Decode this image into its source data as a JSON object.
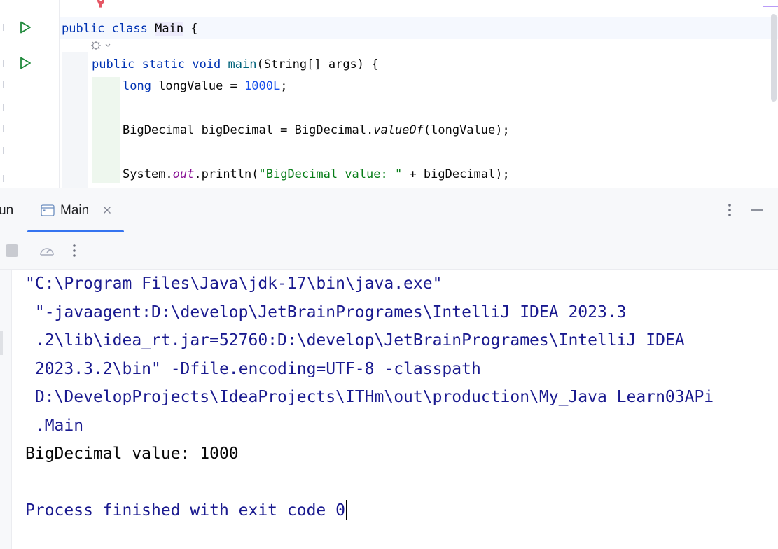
{
  "editor": {
    "lines": [
      {
        "id": "class-decl",
        "tokens": [
          {
            "t": "public",
            "c": "kw"
          },
          {
            "t": " ",
            "c": ""
          },
          {
            "t": "class",
            "c": "kw"
          },
          {
            "t": " ",
            "c": ""
          },
          {
            "t": "Main",
            "c": "cls-hl"
          },
          {
            "t": " {",
            "c": ""
          }
        ]
      },
      {
        "id": "main-decl",
        "tokens": [
          {
            "t": "public",
            "c": "kw"
          },
          {
            "t": " ",
            "c": ""
          },
          {
            "t": "static",
            "c": "kw"
          },
          {
            "t": " ",
            "c": ""
          },
          {
            "t": "void",
            "c": "kw"
          },
          {
            "t": " ",
            "c": ""
          },
          {
            "t": "main",
            "c": "method-decl"
          },
          {
            "t": "(String[] args) {",
            "c": ""
          }
        ]
      },
      {
        "id": "long-decl",
        "tokens": [
          {
            "t": "long",
            "c": "kw"
          },
          {
            "t": " longValue = ",
            "c": ""
          },
          {
            "t": "1000L",
            "c": "num"
          },
          {
            "t": ";",
            "c": ""
          }
        ]
      },
      {
        "id": "bigdecimal-decl",
        "tokens": [
          {
            "t": "BigDecimal bigDecimal = BigDecimal.",
            "c": ""
          },
          {
            "t": "valueOf",
            "c": "static-m"
          },
          {
            "t": "(longValue);",
            "c": ""
          }
        ]
      },
      {
        "id": "println",
        "tokens": [
          {
            "t": "System.",
            "c": ""
          },
          {
            "t": "out",
            "c": "fld"
          },
          {
            "t": ".println(",
            "c": ""
          },
          {
            "t": "\"BigDecimal value: \"",
            "c": "str"
          },
          {
            "t": " + bigDecimal);",
            "c": ""
          }
        ]
      }
    ]
  },
  "toolwindow": {
    "partial_tab_label": "un",
    "active_tab": {
      "label": "Main",
      "icon": "console-window-icon"
    },
    "toolbar_icons": [
      "stop-icon",
      "profiler-icon",
      "more-vertical-icon"
    ],
    "header_icons": [
      "more-vertical-icon",
      "minimize-icon"
    ]
  },
  "console": {
    "lines": [
      {
        "text": "\"C:\\Program Files\\Java\\jdk-17\\bin\\java.exe\"",
        "kind": "cmd"
      },
      {
        "text": " \"-javaagent:D:\\develop\\JetBrainProgrames\\IntelliJ IDEA 2023.3",
        "kind": "cmd"
      },
      {
        "text": " .2\\lib\\idea_rt.jar=52760:D:\\develop\\JetBrainProgrames\\IntelliJ IDEA",
        "kind": "cmd"
      },
      {
        "text": " 2023.3.2\\bin\" -Dfile.encoding=UTF-8 -classpath",
        "kind": "cmd"
      },
      {
        "text": " D:\\DevelopProjects\\IdeaProjects\\ITHm\\out\\production\\My_Java Learn03APi",
        "kind": "cmd"
      },
      {
        "text": " .Main",
        "kind": "cmd"
      },
      {
        "text": "BigDecimal value: 1000",
        "kind": "out"
      },
      {
        "text": "",
        "kind": "out"
      },
      {
        "text": "Process finished with exit code 0",
        "kind": "cmd"
      }
    ]
  },
  "colors": {
    "keyword": "#0033b3",
    "number": "#1750eb",
    "string": "#067d17",
    "static_field": "#871094",
    "console_cmd": "#1a1a8f",
    "console_out": "#080808",
    "accent": "#3574f0",
    "run_icon": "#208a3c"
  }
}
